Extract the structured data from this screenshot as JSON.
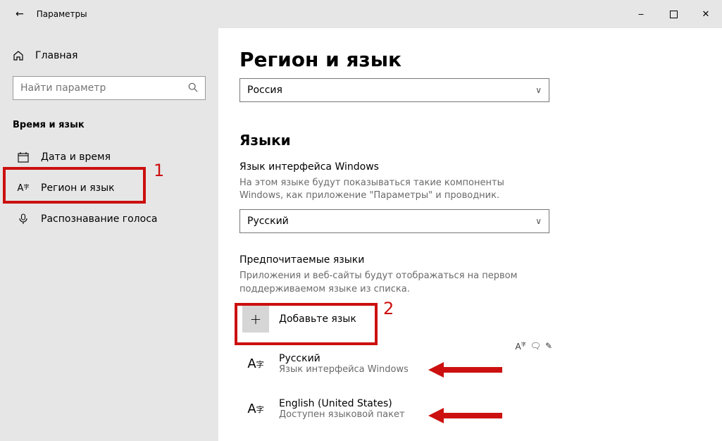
{
  "titlebar": {
    "title": "Параметры"
  },
  "sidebar": {
    "home_label": "Главная",
    "search_placeholder": "Найти параметр",
    "section_title": "Время и язык",
    "items": [
      {
        "label": "Дата и время"
      },
      {
        "label": "Регион и язык"
      },
      {
        "label": "Распознавание голоса"
      }
    ]
  },
  "main": {
    "page_title": "Регион и язык",
    "country_label_hidden": "",
    "country_dropdown": "Россия",
    "languages_heading": "Языки",
    "display_lang_label": "Язык интерфейса Windows",
    "display_lang_desc": "На этом языке будут показываться такие компоненты Windows, как приложение \"Параметры\" и проводник.",
    "display_lang_dropdown": "Русский",
    "preferred_label": "Предпочитаемые языки",
    "preferred_desc": "Приложения и веб-сайты будут отображаться на первом поддерживаемом языке из списка.",
    "add_language_label": "Добавьте язык",
    "langs": [
      {
        "name": "Русский",
        "sub": "Язык интерфейса Windows"
      },
      {
        "name": "English (United States)",
        "sub": "Доступен языковой пакет"
      }
    ]
  },
  "annotations": {
    "box1_num": "1",
    "box2_num": "2"
  }
}
